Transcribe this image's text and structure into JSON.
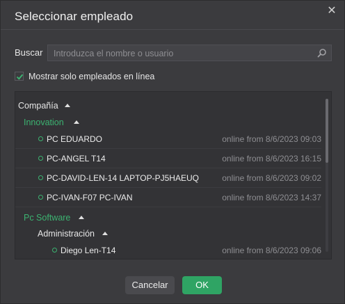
{
  "dialog": {
    "title": "Seleccionar empleado",
    "close_icon": "close-icon"
  },
  "search": {
    "label": "Buscar",
    "placeholder": "Introduzca el nombre o usuario",
    "value": "",
    "icon": "search-icon"
  },
  "online_filter": {
    "label": "Mostrar solo empleados en línea",
    "checked": true
  },
  "tree": {
    "company_header": "Compañía",
    "groups": [
      {
        "name": "Innovation",
        "employees": [
          {
            "name": "PC EDUARDO",
            "status": "online from 8/6/2023 09:03"
          },
          {
            "name": "PC-ANGEL T14",
            "status": "online from 8/6/2023 16:15"
          },
          {
            "name": "PC-DAVID-LEN-14 LAPTOP-PJ5HAEUQ",
            "status": "online from 8/6/2023 09:02"
          },
          {
            "name": "PC-IVAN-F07 PC-IVAN",
            "status": "online from 8/6/2023 14:37"
          }
        ]
      },
      {
        "name": "Pc Software",
        "subgroups": [
          {
            "name": "Administración",
            "employees": [
              {
                "name": "Diego Len-T14",
                "status": "online from 8/6/2023 09:06"
              }
            ]
          }
        ]
      }
    ]
  },
  "footer": {
    "cancel_label": "Cancelar",
    "ok_label": "OK"
  },
  "colors": {
    "accent_green": "#3cb371",
    "ok_button": "#2fa464",
    "background": "#3b3b3e"
  }
}
